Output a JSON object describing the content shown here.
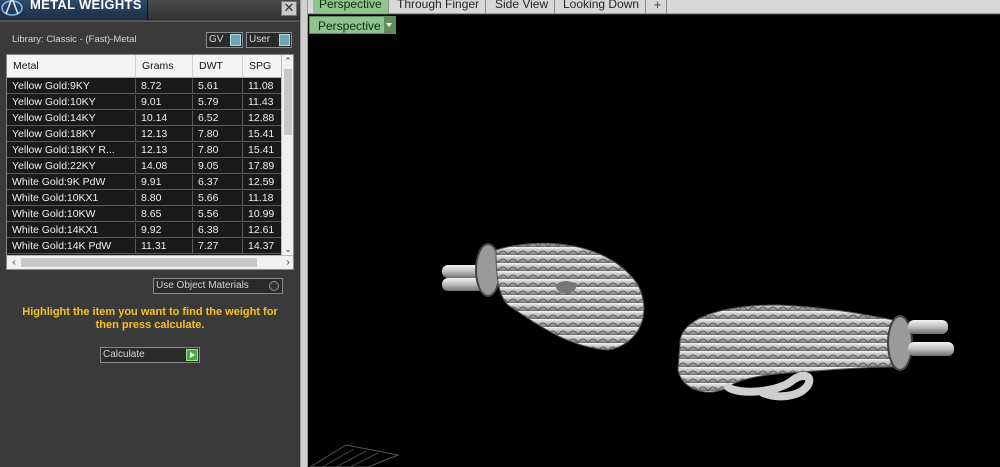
{
  "panel": {
    "title": "METAL WEIGHTS",
    "close_glyph": "✕",
    "library_label": "Library: Classic - (Fast)-Metal",
    "unit_gv": "GV",
    "unit_user": "User",
    "use_object_materials": "Use Object Materials",
    "hint": "Highlight the item you want to find the weight for then press calculate.",
    "calculate_label": "Calculate"
  },
  "table": {
    "columns": [
      "Metal",
      "Grams",
      "DWT",
      "SPG"
    ],
    "rows": [
      [
        "Yellow Gold:9KY",
        "8.72",
        "5.61",
        "11.08"
      ],
      [
        "Yellow Gold:10KY",
        "9.01",
        "5.79",
        "11.43"
      ],
      [
        "Yellow Gold:14KY",
        "10.14",
        "6.52",
        "12.88"
      ],
      [
        "Yellow Gold:18KY",
        "12.13",
        "7.80",
        "15.41"
      ],
      [
        "Yellow Gold:18KY R...",
        "12.13",
        "7.80",
        "15.41"
      ],
      [
        "Yellow Gold:22KY",
        "14.08",
        "9.05",
        "17.89"
      ],
      [
        "White Gold:9K PdW",
        "9.91",
        "6.37",
        "12.59"
      ],
      [
        "White Gold:10KX1",
        "8.80",
        "5.66",
        "11.18"
      ],
      [
        "White Gold:10KW",
        "8.65",
        "5.56",
        "10.99"
      ],
      [
        "White Gold:14KX1",
        "9.92",
        "6.38",
        "12.61"
      ],
      [
        "White Gold:14K PdW",
        "11.31",
        "7.27",
        "14.37"
      ]
    ]
  },
  "viewport": {
    "tabs": [
      "Perspective",
      "Through Finger",
      "Side View",
      "Looking Down"
    ],
    "active_tab": "Perspective",
    "add_tab_glyph": "+",
    "view_dropdown": "Perspective"
  },
  "colors": {
    "accent_tab": "#8ec48e",
    "hint_text": "#f6c323",
    "viewport_bg": "#000000"
  },
  "icons": {
    "logo": "app-logo-icon",
    "close": "close-icon",
    "add_tab": "plus-icon",
    "calculate": "play-arrow-icon"
  }
}
